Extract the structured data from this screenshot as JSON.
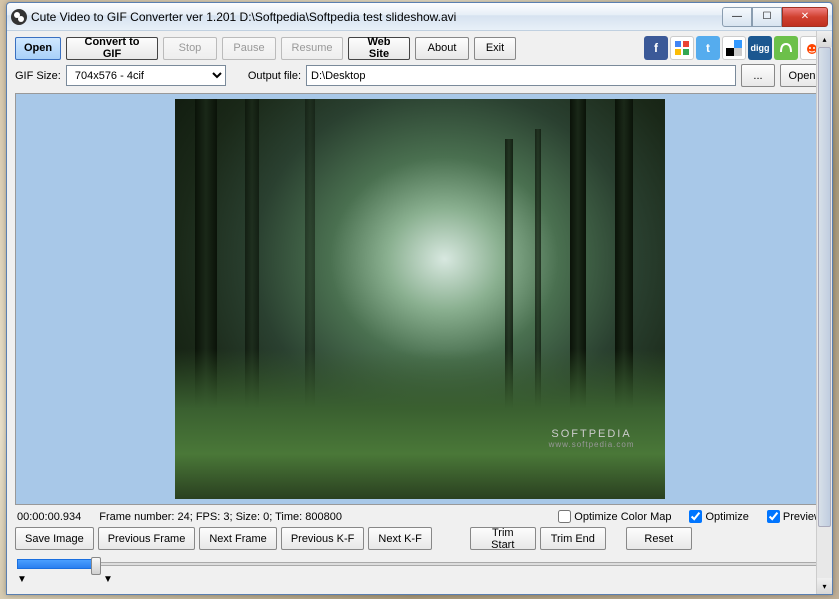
{
  "title": "Cute Video to GIF Converter ver 1.201  D:\\Softpedia\\Softpedia test slideshow.avi",
  "toolbar": {
    "open": "Open",
    "convert": "Convert to GIF",
    "stop": "Stop",
    "pause": "Pause",
    "resume": "Resume",
    "website": "Web Site",
    "about": "About",
    "exit": "Exit"
  },
  "row2": {
    "gifsize_label": "GIF Size:",
    "gifsize_value": "704x576 - 4cif",
    "output_label": "Output file:",
    "output_value": "D:\\Desktop",
    "browse": "...",
    "open": "Open"
  },
  "watermark": {
    "main": "SOFTPEDIA",
    "sub": "www.softpedia.com"
  },
  "status": {
    "time": "00:00:00.934",
    "info": "Frame number: 24; FPS: 3; Size: 0; Time: 800800",
    "opt_colormap": "Optimize Color Map",
    "optimize": "Optimize",
    "preview": "Preview"
  },
  "buttons": {
    "save_image": "Save Image",
    "prev_frame": "Previous Frame",
    "next_frame": "Next Frame",
    "prev_kf": "Previous K-F",
    "next_kf": "Next K-F",
    "trim_start": "Trim Start",
    "trim_end": "Trim End",
    "reset": "Reset"
  },
  "social": [
    "facebook",
    "google",
    "twitter",
    "delicious",
    "digg",
    "stumbleupon",
    "reddit"
  ]
}
